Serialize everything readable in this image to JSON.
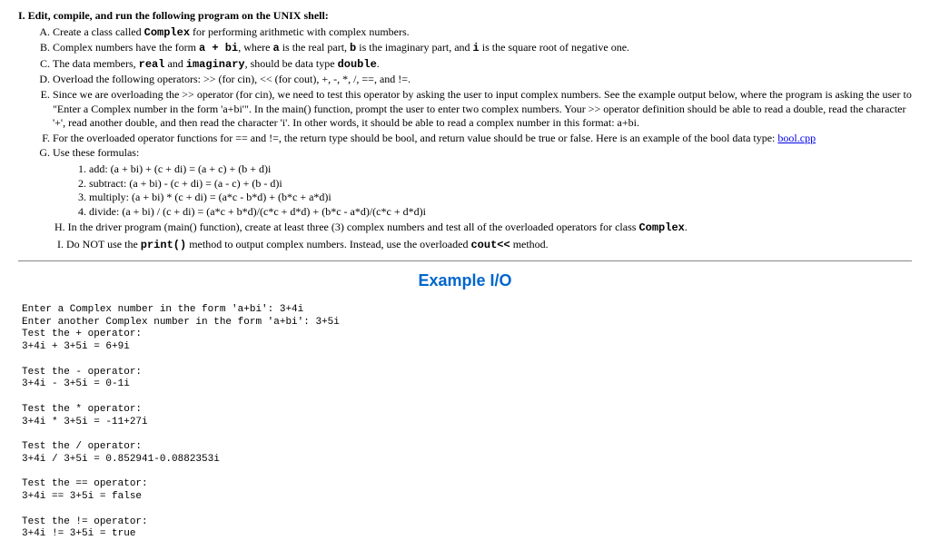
{
  "section": {
    "number": "I.",
    "heading": "Edit, compile, and run the following program on the UNIX shell:",
    "items": {
      "A": {
        "pre": "Create a class called ",
        "code": "Complex",
        "post": " for performing arithmetic with complex numbers."
      },
      "B": {
        "t1": "Complex numbers have the form ",
        "c1": "a + bi",
        "t2": ", where ",
        "c2": "a",
        "t3": " is the real part, ",
        "c3": "b",
        "t4": " is the imaginary part, and ",
        "c4": "i",
        "t5": " is the square root of negative one."
      },
      "C": {
        "t1": "The data members, ",
        "c1": "real",
        "t2": " and ",
        "c2": "imaginary",
        "t3": ", should be data type ",
        "c3": "double",
        "t4": "."
      },
      "D": "Overload the following operators: >> (for cin), << (for cout), +, -, *, /, ==, and !=.",
      "E": "Since we are overloading the >> operator (for cin), we need to test this operator by asking the user to input complex numbers. See the example output below, where the program is asking the user to \"Enter a Complex number in the form 'a+bi'\". In the main() function, prompt the user to enter two complex numbers. Your >> operator definition should be able to read a double, read the character '+', read another double, and then read the character 'i'. In other words, it should be able to read a complex number in this format: a+bi.",
      "F": {
        "t1": "For the overloaded operator functions for == and !=, the return type should be bool, and return value should be true or false. Here is an example of the bool data type: ",
        "link": "bool.cpp"
      },
      "G": "Use these formulas:",
      "G_formulas": {
        "f1": "add: (a + bi) + (c + di) = (a + c) + (b + d)i",
        "f2": "subtract: (a + bi) - (c + di) = (a - c) + (b - d)i",
        "f3": "multiply: (a + bi) * (c + di) = (a*c - b*d) + (b*c + a*d)i",
        "f4": "divide: (a + bi) / (c + di) = (a*c + b*d)/(c*c + d*d) + (b*c - a*d)/(c*c + d*d)i"
      },
      "H": {
        "t1": "In the driver program (main() function), create at least three (3) complex numbers and test all of the overloaded operators for class ",
        "c1": "Complex",
        "t2": "."
      },
      "I": {
        "t1": "Do NOT use the ",
        "c1": "print()",
        "t2": " method to output complex numbers. Instead, use the overloaded ",
        "c2": "cout<<",
        "t3": " method."
      }
    }
  },
  "example_heading": "Example I/O",
  "io": "Enter a Complex number in the form 'a+bi': 3+4i\nEnter another Complex number in the form 'a+bi': 3+5i\nTest the + operator:\n3+4i + 3+5i = 6+9i\n\nTest the - operator:\n3+4i - 3+5i = 0-1i\n\nTest the * operator:\n3+4i * 3+5i = -11+27i\n\nTest the / operator:\n3+4i / 3+5i = 0.852941-0.0882353i\n\nTest the == operator:\n3+4i == 3+5i = false\n\nTest the != operator:\n3+4i != 3+5i = true"
}
